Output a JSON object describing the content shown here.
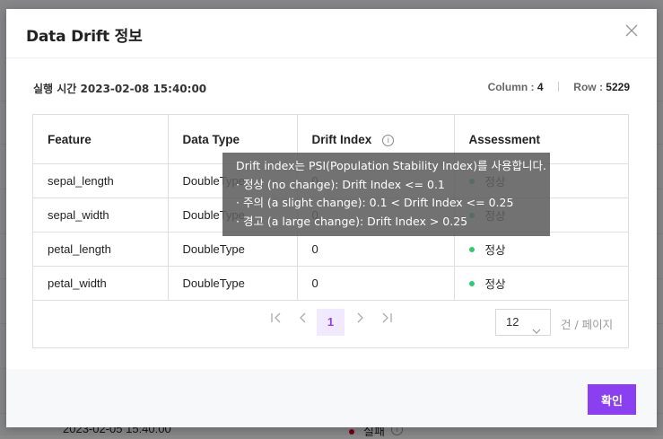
{
  "background": {
    "row_date": "2023-02-05 15:40:00",
    "row_status": "실패"
  },
  "modal": {
    "title": "Data Drift 정보",
    "run_time": "실행 시간 2023-02-08 15:40:00",
    "column_label": "Column :",
    "column_value": "4",
    "row_label": "Row :",
    "row_value": "5229"
  },
  "table": {
    "headers": [
      "Feature",
      "Data Type",
      "Drift Index",
      "Assessment"
    ],
    "rows": [
      {
        "feature": "sepal_length",
        "type": "DoubleType",
        "index": "0",
        "assessment": "정상"
      },
      {
        "feature": "sepal_width",
        "type": "DoubleType",
        "index": "0",
        "assessment": "정상"
      },
      {
        "feature": "petal_length",
        "type": "DoubleType",
        "index": "0",
        "assessment": "정상"
      },
      {
        "feature": "petal_width",
        "type": "DoubleType",
        "index": "0",
        "assessment": "정상"
      }
    ]
  },
  "pagination": {
    "current_page": "1",
    "page_size": "12",
    "page_size_unit": "건 / 페이지"
  },
  "tooltip": {
    "lines": [
      "Drift index는 PSI(Population Stability Index)를 사용합니다.",
      "· 정상 (no change): Drift Index <= 0.1",
      "· 주의 (a slight change): 0.1 < Drift Index <= 0.25",
      "· 경고 (a large change): Drift Index > 0.25"
    ]
  },
  "footer": {
    "confirm_label": "확인"
  },
  "colors": {
    "accent": "#8a3ff0",
    "ok_status": "#2ecc71",
    "fail_status": "#d0021b"
  }
}
